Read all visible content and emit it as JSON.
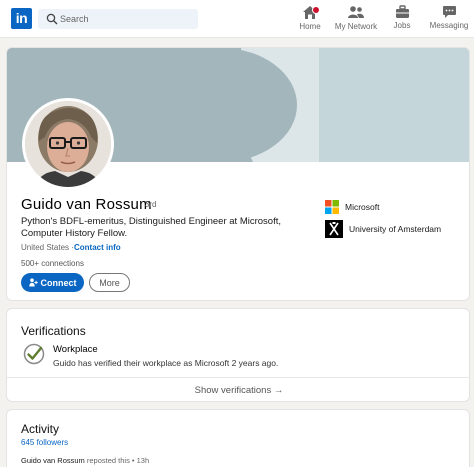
{
  "nav": {
    "logo": "in",
    "search_placeholder": "Search",
    "items": [
      {
        "label": "Home",
        "icon": "home-icon",
        "has_badge": true
      },
      {
        "label": "My Network",
        "icon": "network-icon",
        "has_badge": false
      },
      {
        "label": "Jobs",
        "icon": "briefcase-icon",
        "has_badge": false
      },
      {
        "label": "Messaging",
        "icon": "messaging-icon",
        "has_badge": false
      }
    ]
  },
  "profile": {
    "name": "Guido van Rossum",
    "degree": "· 3rd",
    "headline": "Python's BDFL-emeritus, Distinguished Engineer at Microsoft, Computer History Fellow.",
    "location": "United States ·",
    "contact_info": "Contact info",
    "connections": "500+ connections",
    "connect_label": "Connect",
    "more_label": "More",
    "orgs": [
      {
        "name": "Microsoft",
        "icon": "microsoft-logo"
      },
      {
        "name": "University of Amsterdam",
        "icon": "uva-logo"
      }
    ]
  },
  "verifications": {
    "title": "Verifications",
    "item_title": "Workplace",
    "item_desc": "Guido has verified their workplace as Microsoft 2 years ago.",
    "show_label": "Show verifications →"
  },
  "activity": {
    "title": "Activity",
    "followers": "645 followers",
    "repost_name": "Guido van Rossum",
    "repost_text": "reposted this • 13h"
  },
  "colors": {
    "brand": "#0a66c2",
    "badge": "#cb112d",
    "banner": "#a3b6bc"
  }
}
